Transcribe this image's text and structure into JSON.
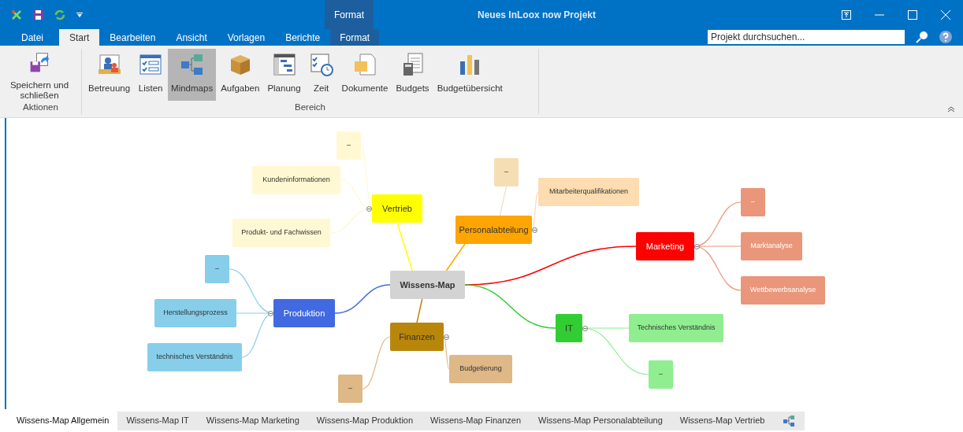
{
  "window": {
    "title": "Neues InLoox now Projekt",
    "context_tab": "Format"
  },
  "ribbon_tabs": [
    {
      "label": "Datei",
      "selected": false,
      "kind": "file"
    },
    {
      "label": "Start",
      "selected": true,
      "kind": "tab"
    },
    {
      "label": "Bearbeiten",
      "selected": false,
      "kind": "tab"
    },
    {
      "label": "Ansicht",
      "selected": false,
      "kind": "tab"
    },
    {
      "label": "Vorlagen",
      "selected": false,
      "kind": "tab"
    },
    {
      "label": "Berichte",
      "selected": false,
      "kind": "tab"
    },
    {
      "label": "Format",
      "selected": false,
      "kind": "context"
    }
  ],
  "search": {
    "placeholder": "Projekt durchsuchen..."
  },
  "ribbon_groups": [
    {
      "label": "Aktionen",
      "buttons": [
        {
          "label": "Speichern und schließen",
          "selected": false
        }
      ]
    },
    {
      "label": "Bereich",
      "buttons": [
        {
          "label": "Betreuung",
          "selected": false
        },
        {
          "label": "Listen",
          "selected": false
        },
        {
          "label": "Mindmaps",
          "selected": true
        },
        {
          "label": "Aufgaben",
          "selected": false
        },
        {
          "label": "Planung",
          "selected": false
        },
        {
          "label": "Zeit",
          "selected": false
        },
        {
          "label": "Dokumente",
          "selected": false
        },
        {
          "label": "Budgets",
          "selected": false
        },
        {
          "label": "Budgetübersicht",
          "selected": false
        }
      ]
    }
  ],
  "mindmap": {
    "root": {
      "label": "Wissens-Map",
      "color": "#d3d3d3",
      "light_text": false,
      "children": [
        {
          "label": "Vertrieb",
          "color": "#ffff00",
          "light_text": false,
          "expanded": true,
          "children": [
            {
              "label": "–",
              "color": "#fff8d2",
              "light_text": false
            },
            {
              "label": "Kundeninformationen",
              "color": "#fff8d2",
              "light_text": false
            },
            {
              "label": "Produkt-  und Fachwissen",
              "color": "#fff8d2",
              "light_text": false
            }
          ]
        },
        {
          "label": "Personalabteilung",
          "color": "#ffa500",
          "light_text": false,
          "expanded": true,
          "children": [
            {
              "label": "–",
              "color": "#f5deb3",
              "light_text": false
            },
            {
              "label": "Mitarbeiterqualifikationen",
              "color": "#fcdcb0",
              "light_text": false
            }
          ]
        },
        {
          "label": "Marketing",
          "color": "#ff0000",
          "light_text": true,
          "expanded": true,
          "children": [
            {
              "label": "–",
              "color": "#e9967a",
              "light_text": true
            },
            {
              "label": "Marktanalyse",
              "color": "#e9967a",
              "light_text": true
            },
            {
              "label": "Wettbewerbsanalyse",
              "color": "#e9967a",
              "light_text": true
            }
          ]
        },
        {
          "label": "Produktion",
          "color": "#4169e1",
          "light_text": true,
          "expanded": true,
          "children": [
            {
              "label": "–",
              "color": "#87ceeb",
              "light_text": false
            },
            {
              "label": "Herstellungsprozess",
              "color": "#87ceeb",
              "light_text": false
            },
            {
              "label": "technisches Verständnis",
              "color": "#87ceeb",
              "light_text": false
            }
          ]
        },
        {
          "label": "Finanzen",
          "color": "#b8860b",
          "light_text": false,
          "expanded": true,
          "children": [
            {
              "label": "Budgetierung",
              "color": "#deb887",
              "light_text": false
            },
            {
              "label": "–",
              "color": "#deb887",
              "light_text": false
            }
          ]
        },
        {
          "label": "IT",
          "color": "#32cd32",
          "light_text": false,
          "expanded": true,
          "children": [
            {
              "label": "Technisches Verständnis",
              "color": "#90ee90",
              "light_text": false
            },
            {
              "label": "–",
              "color": "#90ee90",
              "light_text": false
            }
          ]
        }
      ]
    }
  },
  "view_tabs": [
    {
      "label": "Wissens-Map Allgemein",
      "selected": true
    },
    {
      "label": "Wissens-Map IT",
      "selected": false
    },
    {
      "label": "Wissens-Map Marketing",
      "selected": false
    },
    {
      "label": "Wissens-Map Produktion",
      "selected": false
    },
    {
      "label": "Wissens-Map Finanzen",
      "selected": false
    },
    {
      "label": "Wissens-Map Personalabteilung",
      "selected": false
    },
    {
      "label": "Wissens-Map Vertrieb",
      "selected": false
    }
  ]
}
